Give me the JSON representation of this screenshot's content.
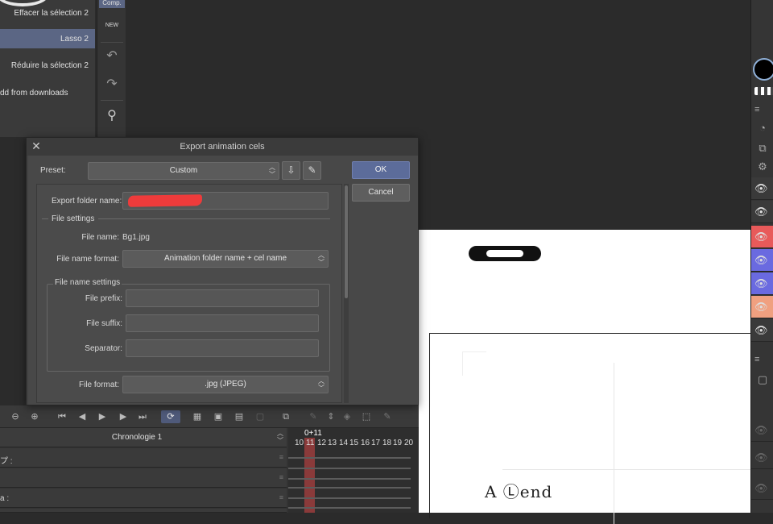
{
  "history": {
    "items": [
      {
        "label": "Effacer la sélection 2",
        "selected": false
      },
      {
        "label": "Lasso 2",
        "selected": true
      },
      {
        "label": "Réduire la sélection 2",
        "selected": false
      },
      {
        "label": "dd from downloads",
        "selected": false
      }
    ]
  },
  "tool_strip": {
    "comp_label": "Comp.",
    "new_badge": "NEW"
  },
  "canvas": {
    "handwriting": "A Ⓛend"
  },
  "dialog": {
    "title": "Export animation cels",
    "close_glyph": "✕",
    "preset_label": "Preset:",
    "preset_value": "Custom",
    "ok_label": "OK",
    "cancel_label": "Cancel",
    "export_folder_label": "Export folder name:",
    "file_settings_label": "File settings",
    "file_name_label": "File name:",
    "file_name_value": "Bg1.jpg",
    "file_name_format_label": "File name format:",
    "file_name_format_value": "Animation folder name + cel name",
    "file_name_settings_label": "File name settings",
    "file_prefix_label": "File prefix:",
    "file_suffix_label": "File suffix:",
    "separator_label": "Separator:",
    "file_format_label": "File format:",
    "file_format_value": ".jpg (JPEG)"
  },
  "timeline": {
    "name": "Chronologie 1",
    "frame_label": "0+11",
    "frames": [
      "10",
      "11",
      "12",
      "13",
      "14",
      "15",
      "16",
      "17",
      "18",
      "19",
      "20"
    ],
    "tracks": [
      {
        "label": "プ :"
      },
      {
        "label": ""
      },
      {
        "label": "a :"
      },
      {
        "label": ""
      }
    ]
  },
  "colors": {
    "accent": "#5c6c9a",
    "selection": "#5b6684",
    "layer_red": "#e85a5a",
    "layer_blue": "#6a6ae0",
    "layer_orange": "#f0a080",
    "playhead": "#8a3a3a"
  }
}
